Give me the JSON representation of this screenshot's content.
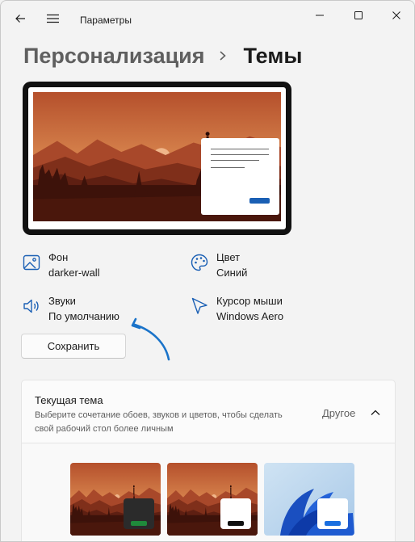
{
  "titlebar": {
    "app_title": "Параметры",
    "icons": {
      "back": "back-arrow-icon",
      "menu": "hamburger-icon",
      "minimize": "minimize-icon",
      "maximize": "maximize-icon",
      "close": "close-icon"
    }
  },
  "breadcrumb": {
    "parent": "Персонализация",
    "current": "Темы"
  },
  "tiles": {
    "background": {
      "label": "Фон",
      "value": "darker-wall",
      "icon": "image-icon"
    },
    "color": {
      "label": "Цвет",
      "value": "Синий",
      "icon": "palette-icon"
    },
    "sounds": {
      "label": "Звуки",
      "value": "По умолчанию",
      "icon": "speaker-icon"
    },
    "cursor": {
      "label": "Курсор мыши",
      "value": "Windows Aero",
      "icon": "cursor-icon"
    }
  },
  "save_button": "Сохранить",
  "current_theme": {
    "title": "Текущая тема",
    "description": "Выберите сочетание обоев, звуков и цветов, чтобы сделать свой рабочий стол более личным",
    "value": "Другое",
    "expanded": true
  },
  "theme_thumbnails": [
    {
      "name": "darker-wall-green",
      "accent": "#1f8a3b",
      "window_color": "#2b2b2b"
    },
    {
      "name": "darker-wall-white",
      "accent": "#111111",
      "window_color": "#ffffff"
    },
    {
      "name": "windows-bloom-blue",
      "accent": "#1a6fe0",
      "window_color": "#ffffff"
    }
  ],
  "colors": {
    "accent": "#1a5fb4",
    "annotation_arrow": "#1a73c9"
  }
}
